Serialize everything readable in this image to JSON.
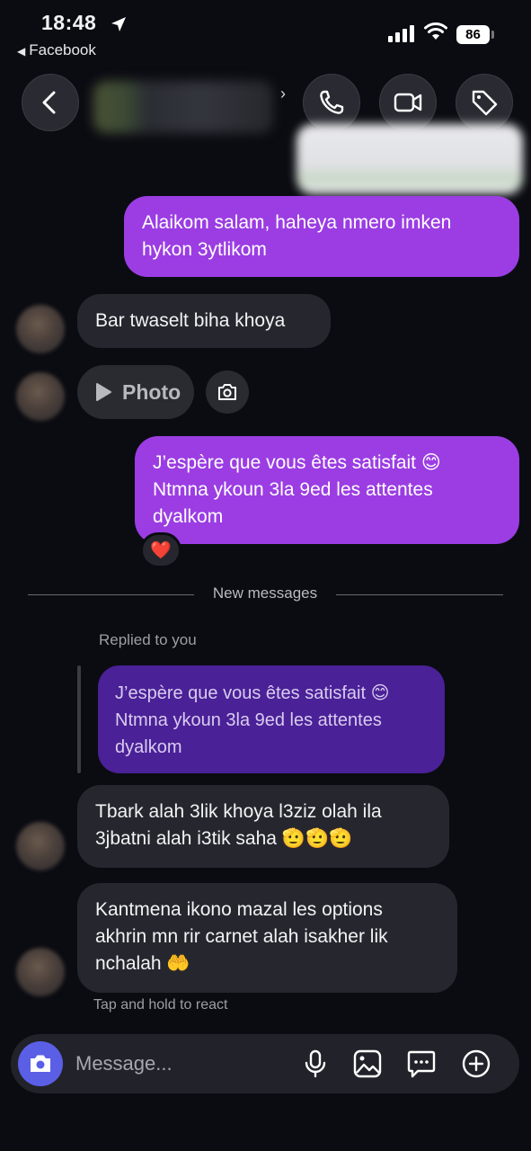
{
  "status": {
    "time": "18:48",
    "back_app": "Facebook",
    "battery": "86"
  },
  "header": {
    "contact_name": "",
    "icons": [
      "back-chevron-icon",
      "phone-icon",
      "video-icon",
      "tag-icon"
    ]
  },
  "messages": {
    "m1": {
      "line1": "Alaikom salam, haheya nmero imken",
      "line2": "hykon 3ytlikom"
    },
    "m2": {
      "text": "Bar twaselt biha khoya"
    },
    "photo": {
      "label": "Photo"
    },
    "m3": {
      "line1": "J’espère que vous êtes satisfait 😊",
      "line2": "Ntmna ykoun 3la 9ed les attentes",
      "line3": "dyalkom",
      "reaction": "❤️"
    },
    "divider_label": "New messages",
    "replied_label": "Replied to you",
    "quoted": {
      "line1": "J’espère que vous êtes satisfait 😊",
      "line2": "Ntmna ykoun 3la 9ed les attentes",
      "line3": "dyalkom"
    },
    "m4": {
      "line1": "Tbark alah 3lik khoya l3ziz olah ila",
      "line2": "3jbatni alah i3tik saha 🫡🫡🫡"
    },
    "m5": {
      "line1": "Kantmena ikono mazal les options",
      "line2": "akhrin mn rir carnet alah isakher lik",
      "line3": "nchalah 🤲"
    },
    "hint": "Tap and hold to react"
  },
  "composer": {
    "placeholder": "Message..."
  }
}
